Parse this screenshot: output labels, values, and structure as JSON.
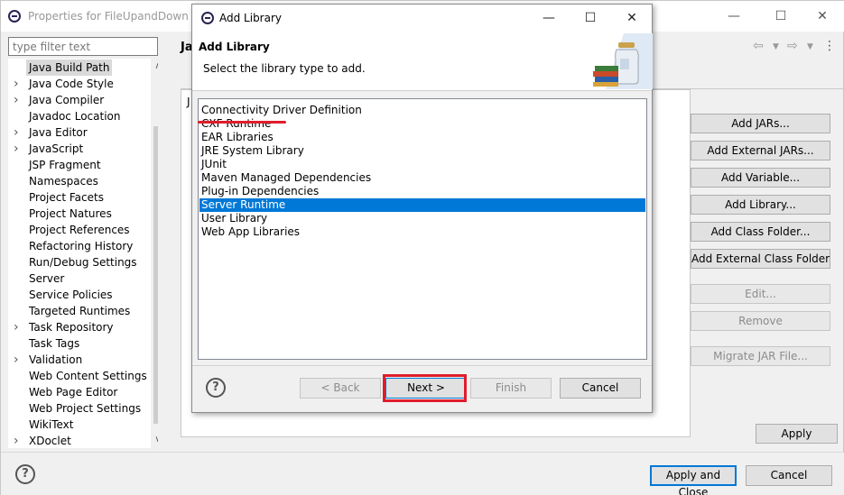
{
  "background_window": {
    "title": "Properties for FileUpandDown",
    "filter_placeholder": "type filter text",
    "page_heading": "Ja",
    "tab_partial": "J",
    "tree_items": [
      {
        "label": "Java Build Path",
        "expandable": false,
        "selected": true
      },
      {
        "label": "Java Code Style",
        "expandable": true,
        "selected": false
      },
      {
        "label": "Java Compiler",
        "expandable": true,
        "selected": false
      },
      {
        "label": "Javadoc Location",
        "expandable": false,
        "selected": false
      },
      {
        "label": "Java Editor",
        "expandable": true,
        "selected": false
      },
      {
        "label": "JavaScript",
        "expandable": true,
        "selected": false
      },
      {
        "label": "JSP Fragment",
        "expandable": false,
        "selected": false
      },
      {
        "label": "Namespaces",
        "expandable": false,
        "selected": false
      },
      {
        "label": "Project Facets",
        "expandable": false,
        "selected": false
      },
      {
        "label": "Project Natures",
        "expandable": false,
        "selected": false
      },
      {
        "label": "Project References",
        "expandable": false,
        "selected": false
      },
      {
        "label": "Refactoring History",
        "expandable": false,
        "selected": false
      },
      {
        "label": "Run/Debug Settings",
        "expandable": false,
        "selected": false
      },
      {
        "label": "Server",
        "expandable": false,
        "selected": false
      },
      {
        "label": "Service Policies",
        "expandable": false,
        "selected": false
      },
      {
        "label": "Targeted Runtimes",
        "expandable": false,
        "selected": false
      },
      {
        "label": "Task Repository",
        "expandable": true,
        "selected": false
      },
      {
        "label": "Task Tags",
        "expandable": false,
        "selected": false
      },
      {
        "label": "Validation",
        "expandable": true,
        "selected": false
      },
      {
        "label": "Web Content Settings",
        "expandable": false,
        "selected": false
      },
      {
        "label": "Web Page Editor",
        "expandable": false,
        "selected": false
      },
      {
        "label": "Web Project Settings",
        "expandable": false,
        "selected": false
      },
      {
        "label": "WikiText",
        "expandable": false,
        "selected": false
      },
      {
        "label": "XDoclet",
        "expandable": true,
        "selected": false
      }
    ],
    "side_buttons": [
      {
        "label": "Add JARs...",
        "enabled": true
      },
      {
        "label": "Add External JARs...",
        "enabled": true
      },
      {
        "label": "Add Variable...",
        "enabled": true
      },
      {
        "label": "Add Library...",
        "enabled": true
      },
      {
        "label": "Add Class Folder...",
        "enabled": true
      },
      {
        "label": "Add External Class Folder...",
        "enabled": true
      },
      {
        "label": "Edit...",
        "enabled": false
      },
      {
        "label": "Remove",
        "enabled": false
      },
      {
        "label": "Migrate JAR File...",
        "enabled": false
      }
    ],
    "apply_label": "Apply",
    "apply_and_close_label": "Apply and Close",
    "cancel_label": "Cancel",
    "help_glyph": "?"
  },
  "dialog": {
    "title": "Add Library",
    "heading": "Add Library",
    "subtitle": "Select the library type to add.",
    "library_types": [
      {
        "label": "Connectivity Driver Definition",
        "selected": false
      },
      {
        "label": "CXF Runtime",
        "selected": false
      },
      {
        "label": "EAR Libraries",
        "selected": false
      },
      {
        "label": "JRE System Library",
        "selected": false
      },
      {
        "label": "JUnit",
        "selected": false
      },
      {
        "label": "Maven Managed Dependencies",
        "selected": false
      },
      {
        "label": "Plug-in Dependencies",
        "selected": false
      },
      {
        "label": "Server Runtime",
        "selected": true
      },
      {
        "label": "User Library",
        "selected": false
      },
      {
        "label": "Web App Libraries",
        "selected": false
      }
    ],
    "buttons": {
      "back": "< Back",
      "next": "Next >",
      "finish": "Finish",
      "cancel": "Cancel"
    },
    "help_glyph": "?"
  },
  "colors": {
    "selection": "#0078d7",
    "annotation_red": "#e01d2a"
  },
  "icons": [
    "eclipse-app-icon",
    "minimize-icon",
    "maximize-icon",
    "close-icon",
    "library-jar-icon",
    "help-icon",
    "back-arrow-icon",
    "forward-arrow-icon",
    "chevron-right-icon",
    "chevron-down-icon"
  ]
}
